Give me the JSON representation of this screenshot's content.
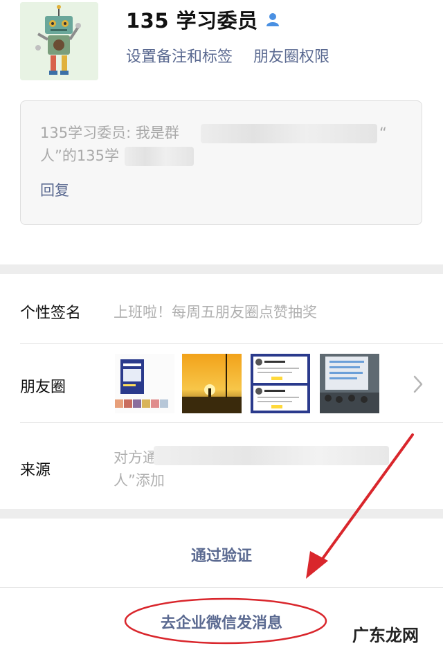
{
  "profile": {
    "name": "135 学习委员",
    "remark_link": "设置备注和标签",
    "moments_permission_link": "朋友圈权限",
    "gender_icon": "person-icon",
    "gender_color": "#4a90e2"
  },
  "message": {
    "line1_visible": "135学习委员: 我是群",
    "line1_end": "“",
    "line2_visible": "人”的135学",
    "reply_label": "回复"
  },
  "details": {
    "signature_label": "个性签名",
    "signature_value": "上班啦！每周五朋友圈点赞抽奖",
    "moments_label": "朋友圈",
    "source_label": "来源",
    "source_value_line1": "对方通",
    "source_value_line2": "人”添加"
  },
  "actions": {
    "verify_label": "通过验证",
    "enterprise_label": "去企业微信发消息"
  },
  "annotations": {
    "arrow_color": "#d9262c",
    "ellipse_color": "#d9262c"
  },
  "watermark": {
    "text": "广东龙网"
  },
  "colors": {
    "link": "#5b6a91",
    "secondary_text": "#b0b0b0",
    "section_gap": "#ededed"
  }
}
